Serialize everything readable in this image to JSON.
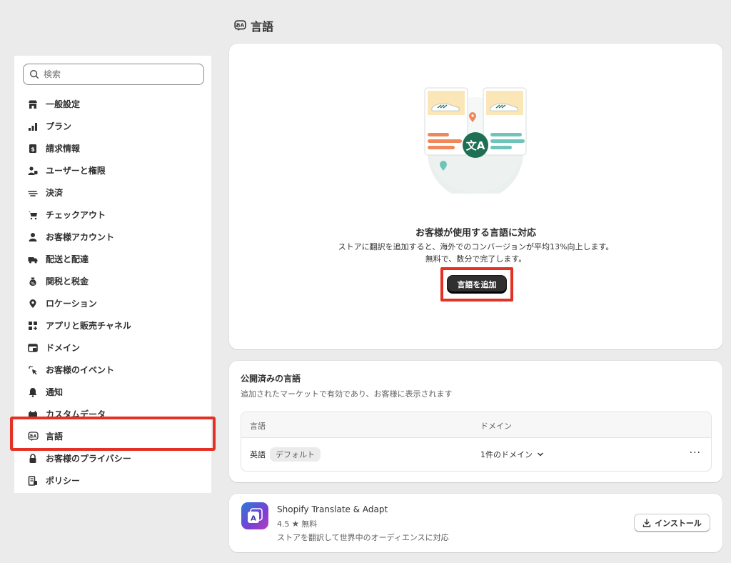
{
  "page": {
    "title": "言語"
  },
  "sidebar": {
    "search_placeholder": "検索",
    "items": [
      {
        "label": "一般設定",
        "icon": "store-icon"
      },
      {
        "label": "プラン",
        "icon": "plan-chart-icon"
      },
      {
        "label": "請求情報",
        "icon": "billing-icon"
      },
      {
        "label": "ユーザーと権限",
        "icon": "users-icon"
      },
      {
        "label": "決済",
        "icon": "payments-icon"
      },
      {
        "label": "チェックアウト",
        "icon": "cart-icon"
      },
      {
        "label": "お客様アカウント",
        "icon": "person-icon"
      },
      {
        "label": "配送と配達",
        "icon": "truck-icon"
      },
      {
        "label": "関税と税金",
        "icon": "tax-bag-icon"
      },
      {
        "label": "ロケーション",
        "icon": "location-pin-icon"
      },
      {
        "label": "アプリと販売チャネル",
        "icon": "apps-icon"
      },
      {
        "label": "ドメイン",
        "icon": "domain-icon"
      },
      {
        "label": "お客様のイベント",
        "icon": "cursor-click-icon"
      },
      {
        "label": "通知",
        "icon": "bell-icon"
      },
      {
        "label": "カスタムデータ",
        "icon": "custom-data-icon"
      },
      {
        "label": "言語",
        "icon": "language-icon",
        "active": true
      },
      {
        "label": "お客様のプライバシー",
        "icon": "lock-icon"
      },
      {
        "label": "ポリシー",
        "icon": "policy-icon"
      }
    ]
  },
  "hero": {
    "title": "お客様が使用する言語に対応",
    "description": "ストアに翻訳を追加すると、海外でのコンバージョンが平均13%向上します。無料で、数分で完了します。",
    "button_label": "言語を追加"
  },
  "published": {
    "title": "公開済みの言語",
    "subtitle": "追加されたマーケットで有効であり、お客様に表示されます",
    "columns": [
      "言語",
      "ドメイン"
    ],
    "rows": [
      {
        "language": "英語",
        "badge": "デフォルト",
        "domain": "1件のドメイン",
        "more": "···"
      }
    ]
  },
  "app": {
    "name": "Shopify Translate & Adapt",
    "rating": "4.5",
    "price": "無料",
    "description": "ストアを翻訳して世界中のオーディエンスに対応",
    "install_label": "インストール"
  },
  "colors": {
    "highlight": "#e53124",
    "primary_button": "#303030",
    "accent_green": "#1e6f53"
  }
}
